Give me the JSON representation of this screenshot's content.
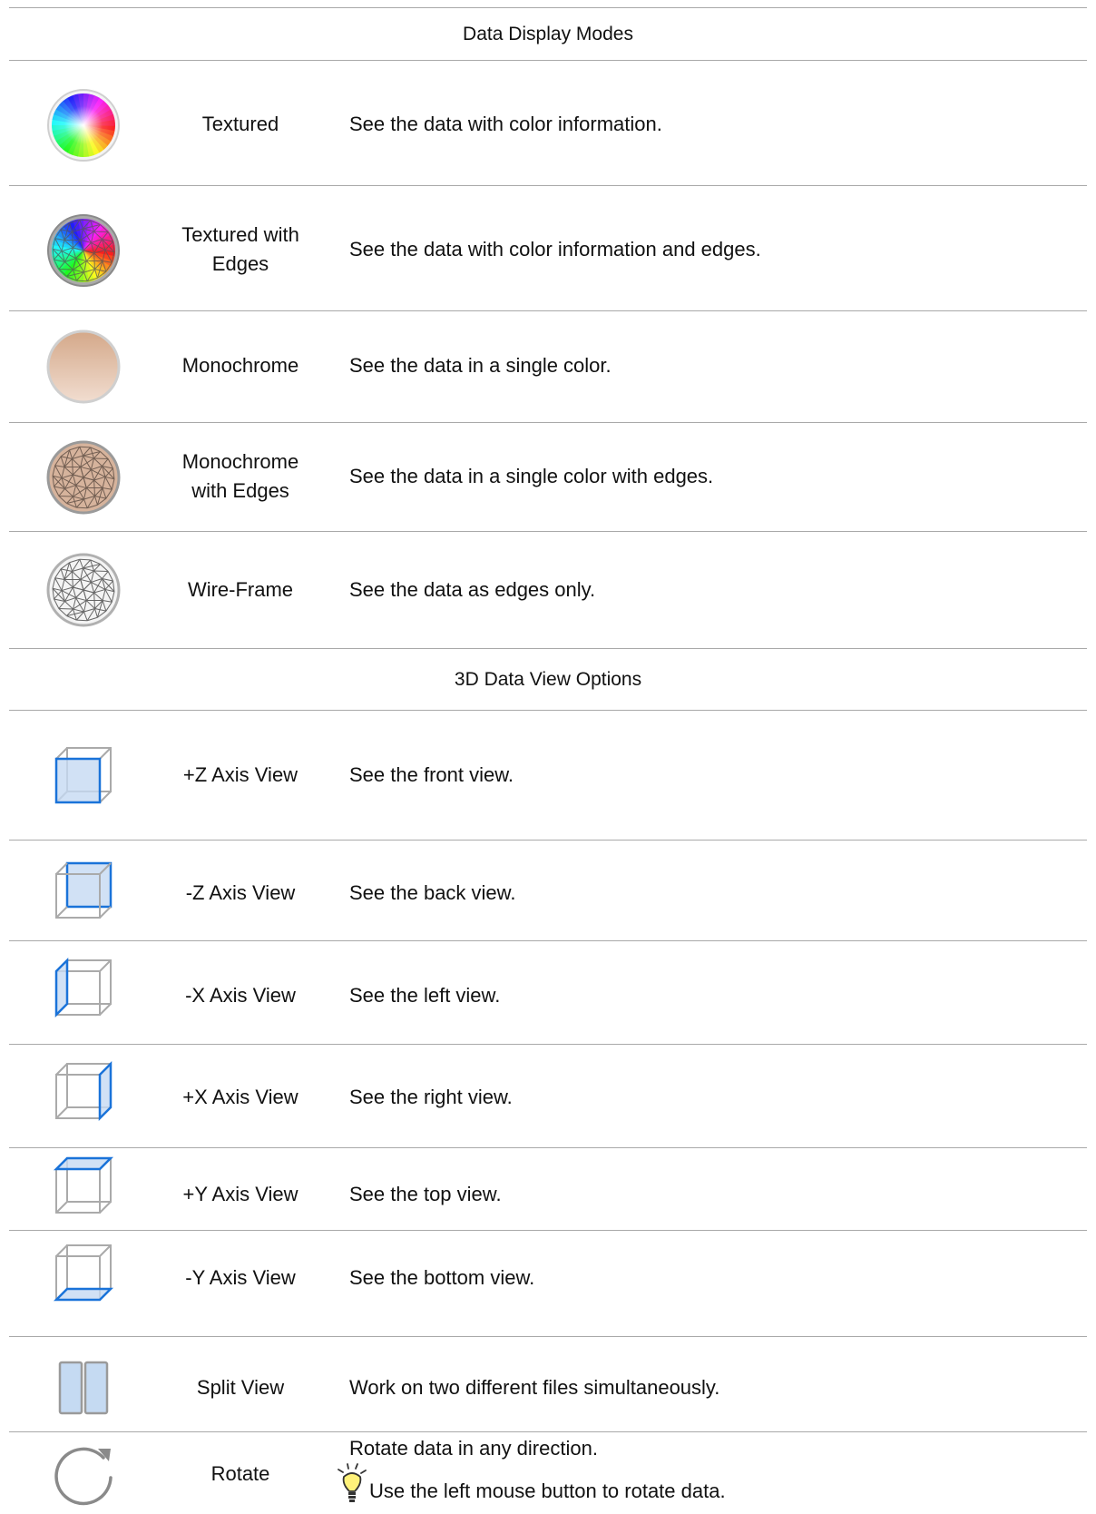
{
  "sections": {
    "display_modes": "Data Display Modes",
    "view_options": "3D Data View Options"
  },
  "display_modes": [
    {
      "icon": "color-wheel-icon",
      "name": "Textured",
      "desc": "See the data with color information."
    },
    {
      "icon": "textured-edges-sphere-icon",
      "name": "Textured with Edges",
      "desc": "See the data with color information and edges."
    },
    {
      "icon": "monochrome-sphere-icon",
      "name": "Monochrome",
      "desc": "See the data in a single color."
    },
    {
      "icon": "monochrome-edges-sphere-icon",
      "name": "Monochrome with Edges",
      "desc": "See the data in a single color with edges."
    },
    {
      "icon": "wireframe-sphere-icon",
      "name": "Wire-Frame",
      "desc": "See the data as edges only."
    }
  ],
  "view_options": [
    {
      "icon": "cube-plus-z-icon",
      "name": "+Z Axis View",
      "desc": "See the front view."
    },
    {
      "icon": "cube-minus-z-icon",
      "name": "-Z Axis View",
      "desc": "See the back view."
    },
    {
      "icon": "cube-minus-x-icon",
      "name": "-X Axis View",
      "desc": "See the left view."
    },
    {
      "icon": "cube-plus-x-icon",
      "name": "+X Axis View",
      "desc": "See the right view."
    },
    {
      "icon": "cube-plus-y-icon",
      "name": "+Y Axis View",
      "desc": "See the top view."
    },
    {
      "icon": "cube-minus-y-icon",
      "name": "-Y Axis View",
      "desc": "See the bottom view."
    },
    {
      "icon": "split-view-icon",
      "name": "Split View",
      "desc": "Work on two different files simultaneously."
    },
    {
      "icon": "rotate-icon",
      "name": "Rotate",
      "desc": "Rotate data in any direction.",
      "tip": "Use the left mouse button to rotate data."
    }
  ],
  "colors": {
    "accent": "#1a73d9",
    "accent_fill": "#c5daf2",
    "line": "#a9a9a9",
    "skin": "#d9b49a"
  }
}
